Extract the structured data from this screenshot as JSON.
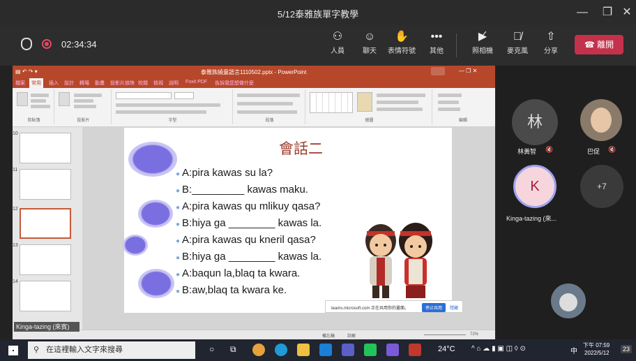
{
  "window": {
    "title": "5/12泰雅族單字教學",
    "min": "—",
    "max": "❐",
    "close": "✕"
  },
  "meeting": {
    "timer": "02:34:34",
    "buttons": [
      {
        "label": "人員",
        "icon": "people-icon"
      },
      {
        "label": "聊天",
        "icon": "chat-icon"
      },
      {
        "label": "表情符號",
        "icon": "reactions-icon"
      },
      {
        "label": "其他",
        "icon": "more-icon"
      },
      {
        "label": "照相機",
        "icon": "camera-off-icon"
      },
      {
        "label": "麥克風",
        "icon": "mic-off-icon"
      },
      {
        "label": "分享",
        "icon": "share-icon"
      }
    ],
    "leave_label": "離開"
  },
  "ppt": {
    "title": "泰雅族繞童語言1110502.pptx - PowerPoint",
    "tabs": [
      "檔案",
      "常用",
      "插入",
      "設計",
      "轉場",
      "動畫",
      "投影片放映",
      "校閱",
      "檢視",
      "說明",
      "Foxit PDF",
      "告訴我您想做什麼"
    ],
    "ribbon_groups": [
      "剪貼簿",
      "投影片",
      "字型",
      "段落",
      "繪圖",
      "編輯"
    ],
    "thumb_numbers": [
      "10",
      "11",
      "12",
      "13",
      "14"
    ],
    "status": {
      "zoom": "72%",
      "notes": "備忘稿",
      "comments": "註解"
    }
  },
  "slide": {
    "title": "會話二",
    "lines": [
      "A:pira  kawas  su  la?",
      "B:_________  kawas maku.",
      "A:pira  kawas  qu  mlikuy  qasa?",
      "B:hiya  ga  ________ kawas la.",
      "A:pira  kawas  qu  kneril  qasa?",
      "B:hiya  ga  ________  kawas  la.",
      "A:baqun la,blaq ta kwara.",
      "B:aw,blaq ta kwara ke."
    ]
  },
  "share_notice": {
    "text": "teams.microsoft.com 正在共用你的畫面。",
    "stop": "停止共用",
    "hide": "隱藏"
  },
  "participants": [
    {
      "initial": "林",
      "name": "林黃智"
    },
    {
      "initial": "",
      "name": "巴促"
    },
    {
      "initial": "K",
      "name": "Kinga-tazing (來..."
    },
    {
      "initial": "+7",
      "name": ""
    }
  ],
  "presenter_tag": "Kinga-tazing (來賓)",
  "taskbar": {
    "search_placeholder": "在這裡輸入文字來搜尋",
    "weather": "24°C",
    "ime": "中",
    "time": "下午 07:59",
    "date": "2022/5/12",
    "badge": "23"
  },
  "colors": {
    "accent_ppt": "#b7472a",
    "leave": "#c4314b",
    "slide_title": "#9b3a2a"
  }
}
